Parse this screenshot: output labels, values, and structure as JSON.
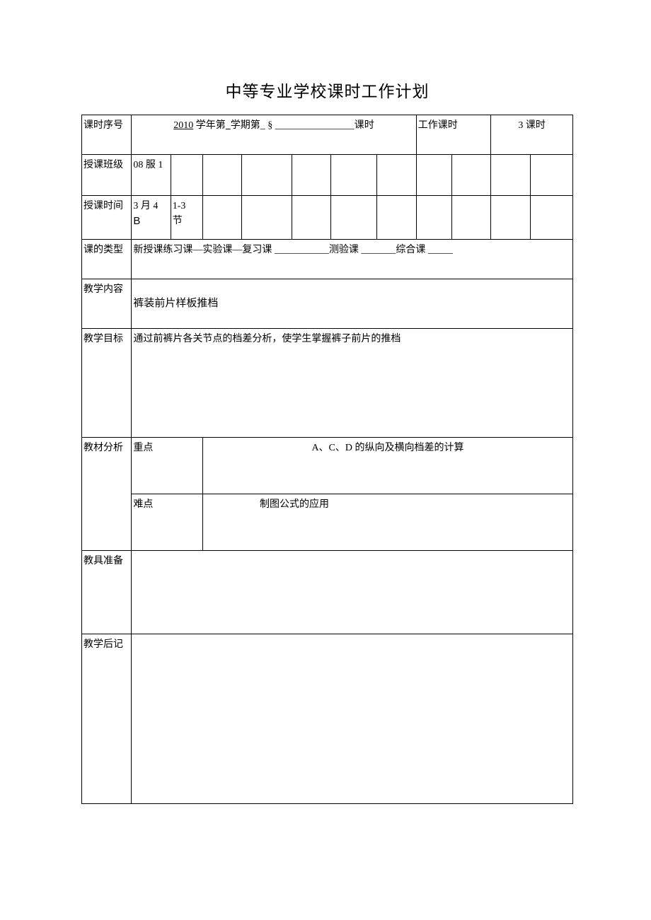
{
  "title": "中等专业学校课时工作计划",
  "row1": {
    "label": "课时序号",
    "content_prefix": "2010",
    "content_middle1": " 学年第",
    "content_middle2": "学期第_ §",
    "content_suffix": "课时",
    "work_label": "工作课时",
    "work_value": "3 课时"
  },
  "row2": {
    "label": "授课班级",
    "class_value": "08 服 1"
  },
  "row3": {
    "label": "授课时间",
    "date": "3 月 4",
    "date_sub": "B",
    "period": "1-3",
    "period_sub": "节"
  },
  "row4": {
    "label": "课的类型",
    "content": "新授课练习课—实验课—复习课 ___________测验课 _______综合课 _____"
  },
  "row5": {
    "label": "教学内容",
    "content": "裤装前片样板推档"
  },
  "row6": {
    "label": "教学目标",
    "content": "通过前裤片各关节点的档差分析，使学生掌握裤子前片的推档"
  },
  "row7": {
    "label": "教材分析",
    "sub1_label": "重点",
    "sub1_content": "A、C、D 的纵向及横向档差的计算",
    "sub2_label": "难点",
    "sub2_content": "制图公式的应用"
  },
  "row8": {
    "label": "教具准备"
  },
  "row9": {
    "label": "教学后记"
  }
}
